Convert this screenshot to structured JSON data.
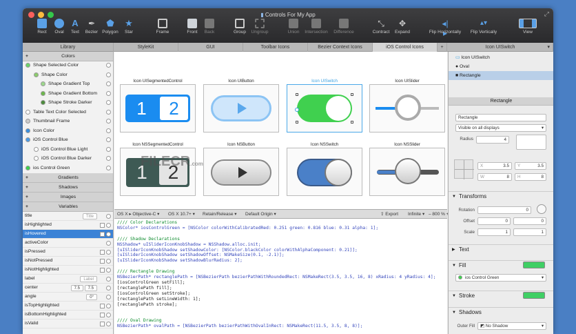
{
  "window": {
    "title": "Controls For My App"
  },
  "toolbar": {
    "rect": "Rect",
    "oval": "Oval",
    "text": "Text",
    "bezier": "Bezier",
    "polygon": "Polygon",
    "star": "Star",
    "frame": "Frame",
    "front": "Front",
    "back": "Back",
    "group": "Group",
    "ungroup": "Ungroup",
    "union": "Union",
    "intersection": "Intersection",
    "difference": "Difference",
    "contract": "Contract",
    "expand": "Expand",
    "flip_h": "Flip Horizontally",
    "flip_v": "Flip Vertically",
    "view": "View"
  },
  "tabs": [
    "Library",
    "StyleKit",
    "GUI",
    "Toolbar Icons",
    "Bezier Context Icons",
    "iOS Control Icons",
    "+",
    "Icon UISwitch"
  ],
  "library": {
    "colors_header": "Colors",
    "colors": [
      "Shape Selected Color",
      "Shape Color",
      "Shape Gradient Top",
      "Shape Gradient Bottom",
      "Shape Stroke Darker",
      "Table Text Color Selected",
      "Thumbnail Frame",
      "Icon Color",
      "iOS Control Blue",
      "iOS Control Blue Light",
      "iOS Control Blue Darker",
      "ios Control Green"
    ],
    "gradients": "Gradients",
    "shadows": "Shadows",
    "images": "Images",
    "variables": "Variables",
    "variables_list": [
      "title",
      "isHighlighted",
      "isHovered",
      "activeColor",
      "isPressed",
      "isNotPressed",
      "isNotHighlighted",
      "label",
      "center",
      "angle",
      "isTopHighlighted",
      "isBottomHighlighted",
      "isValid"
    ],
    "title_value": "Title",
    "label_value": "Label",
    "center_x": "7.5",
    "center_y": "7.5",
    "angle_value": "0°"
  },
  "cells": [
    "Icon UISegmentedControl",
    "Icon UIButton",
    "Icon UISwitch",
    "Icon UISlider",
    "Icon NSSegmentedControl",
    "Icon NSButton",
    "Icon NSSwitch",
    "Icon NSSlider"
  ],
  "segment": {
    "one": "1",
    "two": "2"
  },
  "codebar": {
    "platform": "OS X ▸ Objective-C",
    "version": "OS X 10.7+",
    "memory": "Retain/Release",
    "origin": "Default Origin",
    "export": "Export",
    "zoom_mode": "Infinite",
    "zoom": "800 %"
  },
  "code": [
    "//// Color Declarations",
    "NSColor* iosControlGreen = [NSColor colorWithCalibratedRed: 0.251 green: 0.816 blue: 0.31 alpha: 1];",
    "",
    "//// Shadow Declarations",
    "NSShadow* uISliderIconKnobShadow = NSShadow.alloc.init;",
    "[uISliderIconKnobShadow setShadowColor: [NSColor.blackColor colorWithAlphaComponent: 0.21]];",
    "[uISliderIconKnobShadow setShadowOffset: NSMakeSize(0.1, -2.1)];",
    "[uISliderIconKnobShadow setShadowBlurRadius: 2];",
    "",
    "//// Rectangle Drawing",
    "NSBezierPath* rectanglePath = [NSBezierPath bezierPathWithRoundedRect: NSMakeRect(3.5, 3.5, 16, 8) xRadius: 4 yRadius: 4];",
    "[iosControlGreen setFill];",
    "[rectanglePath fill];",
    "[iosControlGreen setStroke];",
    "[rectanglePath setLineWidth: 1];",
    "[rectanglePath stroke];",
    "",
    "",
    "//// Oval Drawing",
    "NSBezierPath* ovalPath = [NSBezierPath bezierPathWithOvalInRect: NSMakeRect(11.5, 3.5, 8, 8)];"
  ],
  "inspector": {
    "tree": [
      "Icon UISwitch",
      "Oval",
      "Rectangle"
    ],
    "header": "Rectangle",
    "name_value": "Rectangle",
    "visibility": "Visible on all displays",
    "radius_label": "Radius",
    "radius_value": "4",
    "x_label": "X",
    "x_value": "3.5",
    "y_label": "Y",
    "y_value": "3.5",
    "w_label": "W",
    "w_value": "8",
    "h_label": "H",
    "h_value": "8",
    "transforms": "Transforms",
    "rotation_label": "Rotation",
    "rotation_value": "0",
    "offset_label": "Offset",
    "offset_x": "0",
    "offset_y": "0",
    "scale_label": "Scale",
    "scale_x": "1",
    "scale_y": "1",
    "text": "Text",
    "fill": "Fill",
    "fill_color": "ios Control Green",
    "stroke": "Stroke",
    "shadows": "Shadows",
    "outer_fill_label": "Outer Fill",
    "outer_fill_value": "No Shadow"
  },
  "colors": {
    "green": "#40d04f",
    "blue": "#1a8cf0",
    "selected": "#3b82d6"
  }
}
